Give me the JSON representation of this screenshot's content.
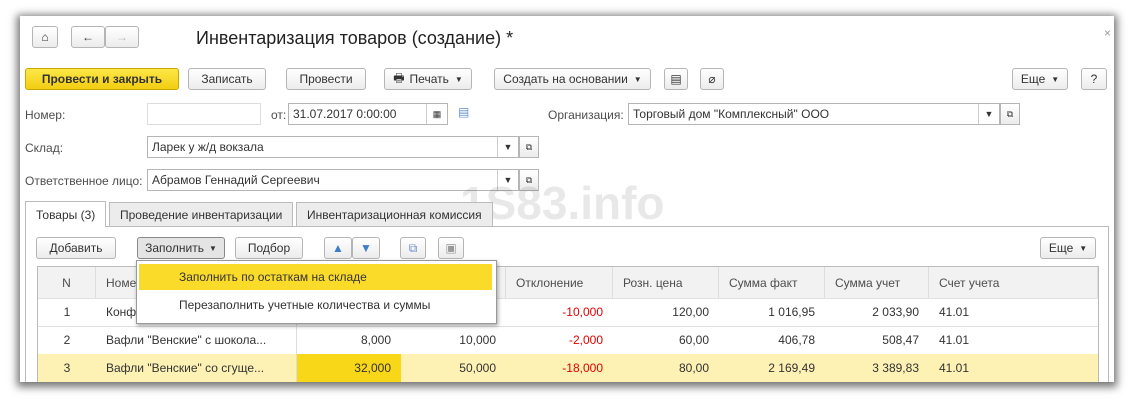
{
  "title": "Инвентаризация товаров (создание) *",
  "watermark": "1S83.info",
  "toolbar": {
    "post_close": "Провести и закрыть",
    "save": "Записать",
    "post": "Провести",
    "print": "Печать",
    "create_based": "Создать на основании",
    "more": "Еще",
    "help": "?"
  },
  "form": {
    "number_label": "Номер:",
    "number_value": "",
    "date_label": "от:",
    "date_value": "31.07.2017  0:00:00",
    "org_label": "Организация:",
    "org_value": "Торговый дом \"Комплексный\" ООО",
    "warehouse_label": "Склад:",
    "warehouse_value": "Ларек у ж/д вокзала",
    "person_label": "Ответственное лицо:",
    "person_value": "Абрамов Геннадий Сергеевич"
  },
  "tabs": [
    {
      "label": "Товары (3)"
    },
    {
      "label": "Проведение инвентаризации"
    },
    {
      "label": "Инвентаризационная комиссия"
    }
  ],
  "table_toolbar": {
    "add": "Добавить",
    "fill": "Заполнить",
    "pick": "Подбор",
    "more": "Еще"
  },
  "fill_menu": [
    "Заполнить по остаткам на складе",
    "Перезаполнить учетные количества и суммы"
  ],
  "columns": [
    "N",
    "Номенклатура",
    "",
    "",
    "Отклонение",
    "Розн. цена",
    "Сумма факт",
    "Сумма учет",
    "Счет учета"
  ],
  "rows": [
    {
      "n": "1",
      "name": "Конф",
      "fact": "",
      "acc": "",
      "dev": "-10,000",
      "price": "120,00",
      "sum_fact": "1 016,95",
      "sum_acc": "2 033,90",
      "account": "41.01"
    },
    {
      "n": "2",
      "name": "Вафли \"Венские\" с шокола...",
      "fact": "8,000",
      "acc": "10,000",
      "dev": "-2,000",
      "price": "60,00",
      "sum_fact": "406,78",
      "sum_acc": "508,47",
      "account": "41.01"
    },
    {
      "n": "3",
      "name": "Вафли \"Венские\" со сгуще...",
      "fact": "32,000",
      "acc": "50,000",
      "dev": "-18,000",
      "price": "80,00",
      "sum_fact": "2 169,49",
      "sum_acc": "3 389,83",
      "account": "41.01"
    }
  ]
}
